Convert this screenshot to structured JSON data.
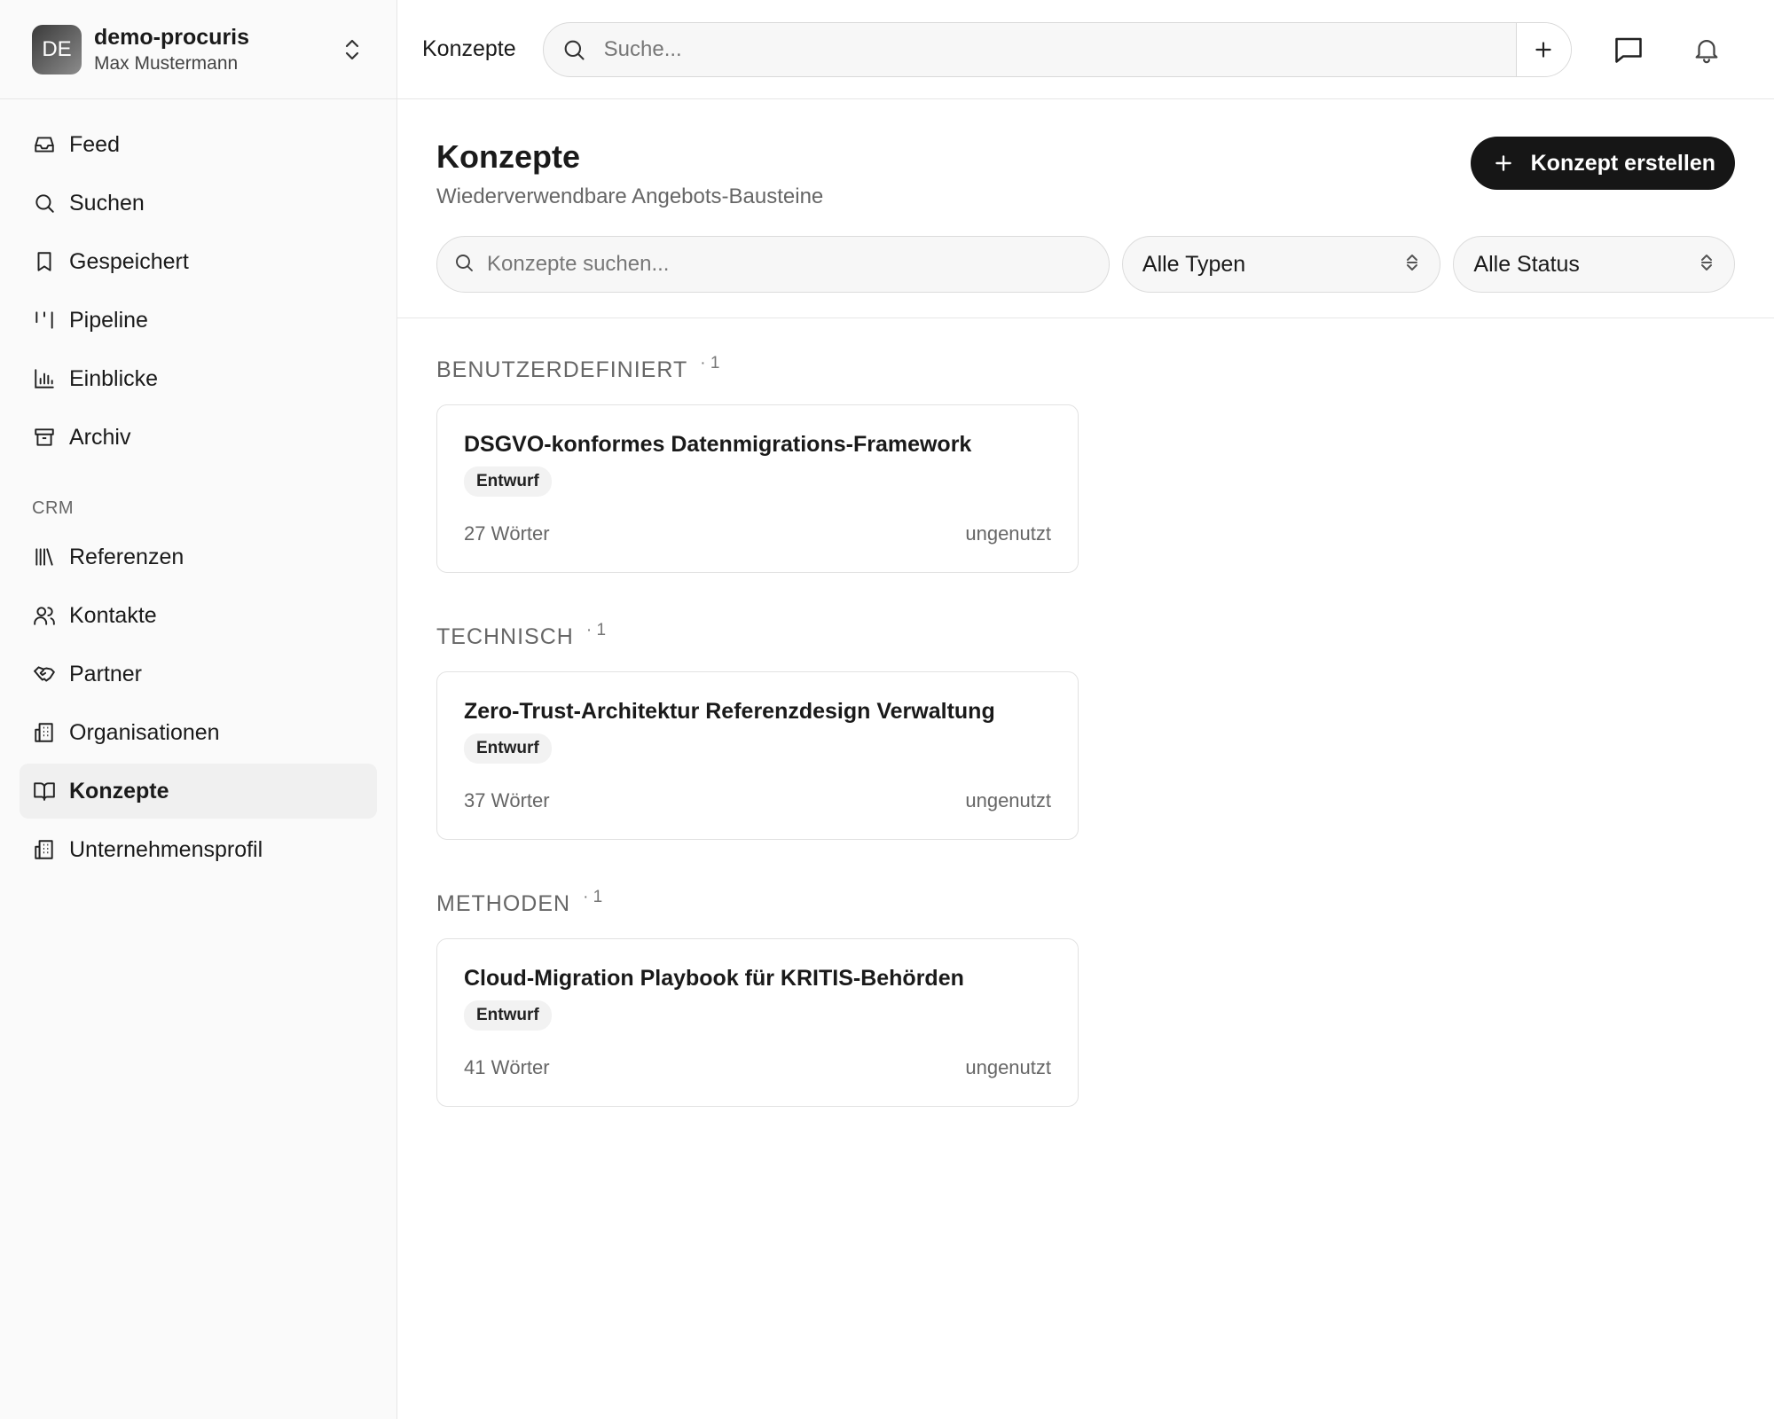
{
  "workspace": {
    "initials": "DE",
    "name": "demo-procuris",
    "user": "Max Mustermann"
  },
  "sidebar": {
    "items": [
      {
        "label": "Feed",
        "icon": "inbox-icon"
      },
      {
        "label": "Suchen",
        "icon": "search-icon"
      },
      {
        "label": "Gespeichert",
        "icon": "bookmark-icon"
      },
      {
        "label": "Pipeline",
        "icon": "pipeline-icon"
      },
      {
        "label": "Einblicke",
        "icon": "bar-chart-icon"
      },
      {
        "label": "Archiv",
        "icon": "archive-icon"
      }
    ],
    "crm_title": "CRM",
    "crm_items": [
      {
        "label": "Referenzen",
        "icon": "library-icon"
      },
      {
        "label": "Kontakte",
        "icon": "users-icon"
      },
      {
        "label": "Partner",
        "icon": "handshake-icon"
      },
      {
        "label": "Organisationen",
        "icon": "building-icon"
      },
      {
        "label": "Konzepte",
        "icon": "book-open-icon",
        "active": true
      },
      {
        "label": "Unternehmensprofil",
        "icon": "building-icon"
      }
    ]
  },
  "topbar": {
    "breadcrumb": "Konzepte",
    "search_placeholder": "Suche..."
  },
  "header": {
    "title": "Konzepte",
    "subtitle": "Wiederverwendbare Angebots-Bausteine",
    "create_label": "Konzept erstellen"
  },
  "filters": {
    "search_placeholder": "Konzepte suchen...",
    "type_value": "Alle Typen",
    "status_value": "Alle Status"
  },
  "sections": [
    {
      "title": "BENUTZERDEFINIERT",
      "count": "· 1",
      "cards": [
        {
          "title": "DSGVO-konformes Datenmigrations-Framework",
          "badge": "Entwurf",
          "words": "27 Wörter",
          "usage": "ungenutzt"
        }
      ]
    },
    {
      "title": "TECHNISCH",
      "count": "· 1",
      "cards": [
        {
          "title": "Zero-Trust-Architektur Referenzdesign Verwaltung",
          "badge": "Entwurf",
          "words": "37 Wörter",
          "usage": "ungenutzt"
        }
      ]
    },
    {
      "title": "METHODEN",
      "count": "· 1",
      "cards": [
        {
          "title": "Cloud-Migration Playbook für KRITIS-Behörden",
          "badge": "Entwurf",
          "words": "41 Wörter",
          "usage": "ungenutzt"
        }
      ]
    }
  ],
  "colors": {
    "primary_button": "#161616",
    "sidebar_bg": "#fafafa",
    "active_item_bg": "#f0f0f0"
  }
}
